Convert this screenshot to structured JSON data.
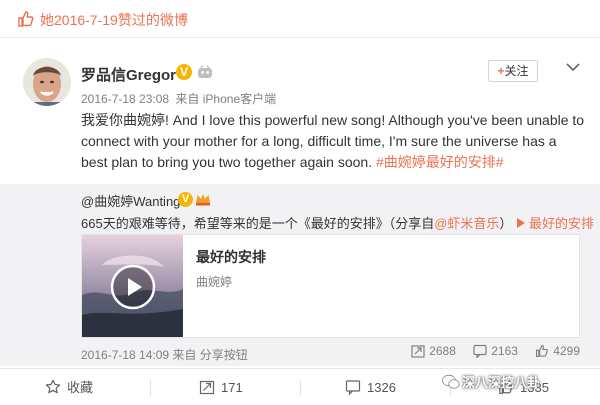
{
  "liked_bar": {
    "text": "她2016-7-19赞过的微博"
  },
  "post": {
    "author": "罗品信Gregor",
    "verified_mark": "V",
    "follow_label": "关注",
    "follow_plus": "+",
    "meta": {
      "time": "2016-7-18 23:08",
      "source": "来自 iPhone客户端"
    },
    "text_main": "我爱你曲婉婷! And I love this powerful new song! Although you've been unable to connect with your mother for a long, difficult time, I'm sure the universe has a best plan to bring you two together again soon.",
    "topic": "#曲婉婷最好的安排#"
  },
  "repost": {
    "author": "@曲婉婷Wanting",
    "verified_mark": "V",
    "text_prefix": "665天的艰难等待，希望等来的是一个《最好的安排》（分享自",
    "share_source": "@虾米音乐",
    "text_suffix": "）",
    "song_link": "最好的安排",
    "card": {
      "title": "最好的安排",
      "artist": "曲婉婷"
    },
    "meta": {
      "time": "2016-7-18 14:09",
      "source": "来自 分享按钮"
    },
    "stats": {
      "reposts": "2688",
      "comments": "2163",
      "likes": "4299"
    }
  },
  "actions": {
    "favorite": "收藏",
    "repost": "171",
    "comment": "1326",
    "like": "1335"
  },
  "watermark": {
    "text": "深八深挖八卦"
  },
  "colors": {
    "accent": "#eb7350",
    "verified": "#f7b500",
    "repost_bg": "#f2f2f5"
  }
}
